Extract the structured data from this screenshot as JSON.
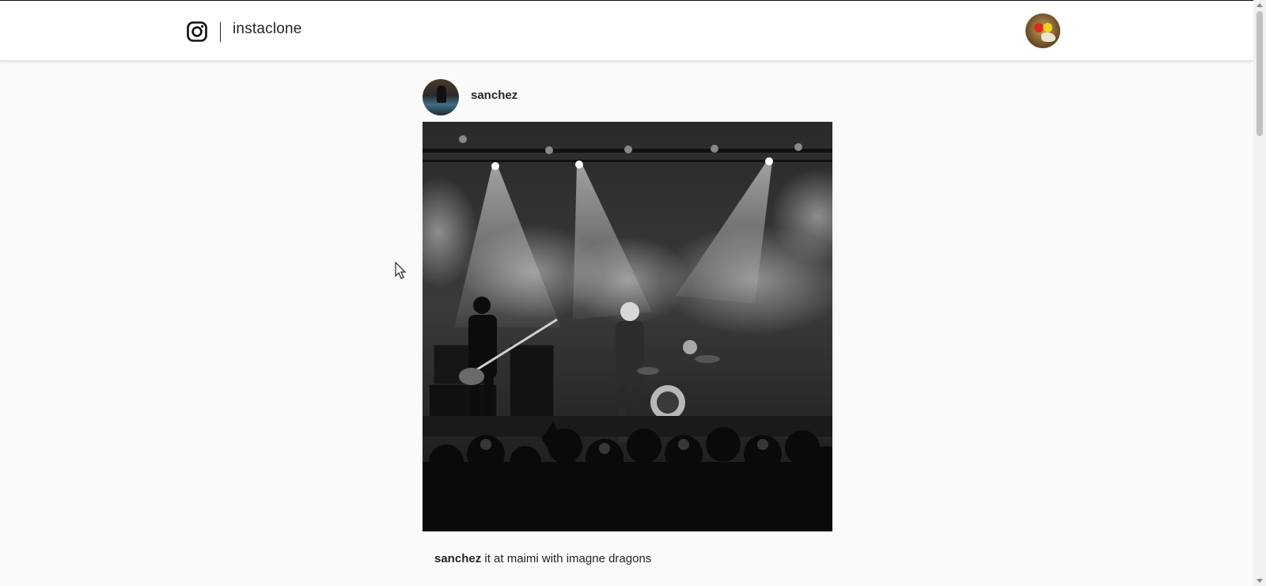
{
  "header": {
    "logo_icon": "instagram-icon",
    "brand": "instaclone",
    "user_avatar_icon": "avatar"
  },
  "post": {
    "username": "sanchez",
    "avatar_icon": "avatar",
    "image_icon": "concert-photo",
    "caption": {
      "username": "sanchez",
      "text": " it at maimi with imagne dragons"
    }
  },
  "colors": {
    "background": "#fafafa",
    "header_bg": "#ffffff",
    "text": "#262626"
  }
}
